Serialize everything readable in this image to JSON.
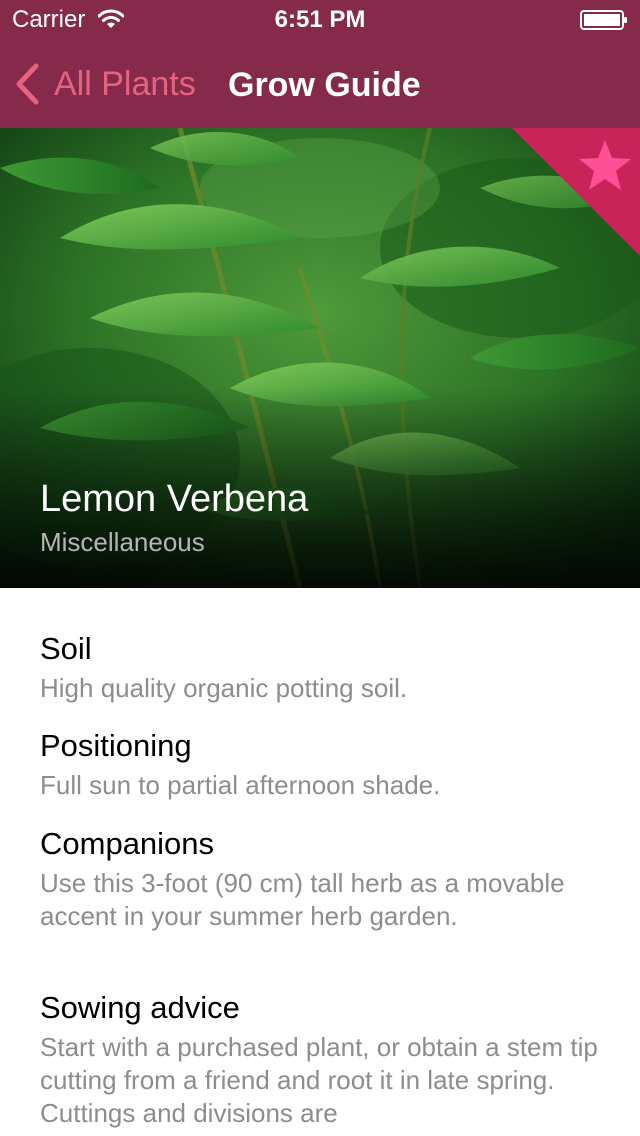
{
  "status_bar": {
    "carrier": "Carrier",
    "time": "6:51 PM"
  },
  "nav": {
    "back_label": "All Plants",
    "title": "Grow Guide"
  },
  "plant": {
    "name": "Lemon Verbena",
    "category": "Miscellaneous",
    "favorited": true
  },
  "sections": [
    {
      "heading": "Soil",
      "body": "High quality organic potting soil."
    },
    {
      "heading": "Positioning",
      "body": "Full sun to partial afternoon shade."
    },
    {
      "heading": "Companions",
      "body": "Use this 3-foot (90 cm) tall herb as a movable accent in your summer herb garden."
    },
    {
      "heading": "Sowing advice",
      "body": "Start with a purchased plant, or obtain a stem tip cutting from a friend and root it in late spring. Cuttings and divisions are"
    }
  ],
  "icons": {
    "back": "chevron-left-icon",
    "favorite": "star-icon",
    "wifi": "wifi-icon",
    "battery": "battery-icon"
  },
  "colors": {
    "nav_background": "#852a4b",
    "accent": "#e5637f",
    "favorite_ribbon": "#c8245a",
    "favorite_star": "#ff4f95",
    "body_text": "#8d8d8d"
  }
}
